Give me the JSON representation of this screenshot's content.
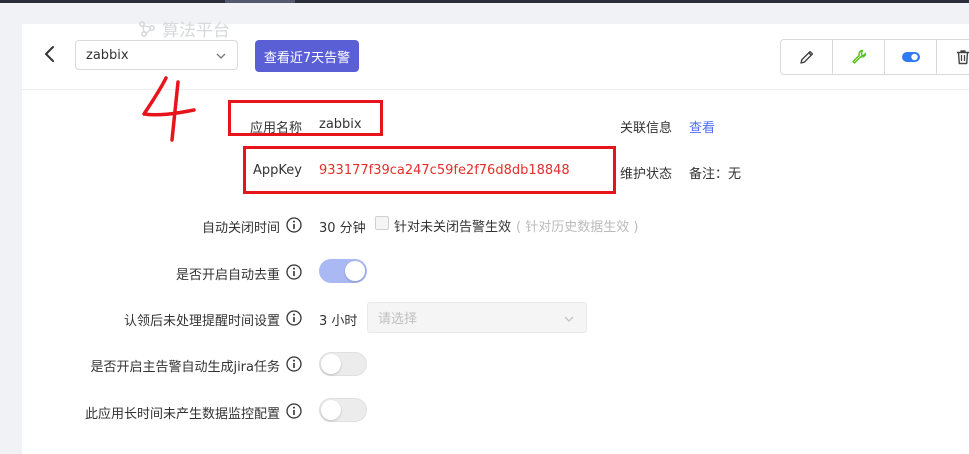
{
  "header": {
    "watermark_text": "算法平台",
    "app_select_value": "zabbix",
    "alerts_button_label": "查看近7天告警",
    "toolbar": [
      {
        "name": "edit-button",
        "icon": "pencil-icon",
        "color": "#444444"
      },
      {
        "name": "config-button",
        "icon": "wrench-icon",
        "color": "#52c41a"
      },
      {
        "name": "toggle-button",
        "icon": "toggle-icon",
        "color": "#2f7bf5"
      },
      {
        "name": "delete-button",
        "icon": "trash-icon",
        "color": "#444444"
      }
    ]
  },
  "info": {
    "app_name_label": "应用名称",
    "app_name_value": "zabbix",
    "related_label": "关联信息",
    "related_link": "查看",
    "appkey_label": "AppKey",
    "appkey_value": "933177f39ca247c59fe2f76d8db18848",
    "maintenance_label": "维护状态",
    "maintenance_value": "备注：无"
  },
  "settings": {
    "auto_close_label": "自动关闭时间",
    "auto_close_value": "30 分钟",
    "auto_close_checkbox_label": "针对未关闭告警生效",
    "auto_close_checkbox_hint": "( 针对历史数据生效 )",
    "auto_close_checkbox_checked": false,
    "dedup_label": "是否开启自动去重",
    "dedup_enabled": true,
    "remind_label": "认领后未处理提醒时间设置",
    "remind_value": "3 小时",
    "remind_select_placeholder": "请选择",
    "jira_label": "是否开启主告警自动生成jira任务",
    "jira_enabled": false,
    "monitor_label": "此应用长时间未产生数据监控配置",
    "monitor_enabled": false
  },
  "annotation": {
    "handwritten_number": "4",
    "color": "#e8141c"
  }
}
